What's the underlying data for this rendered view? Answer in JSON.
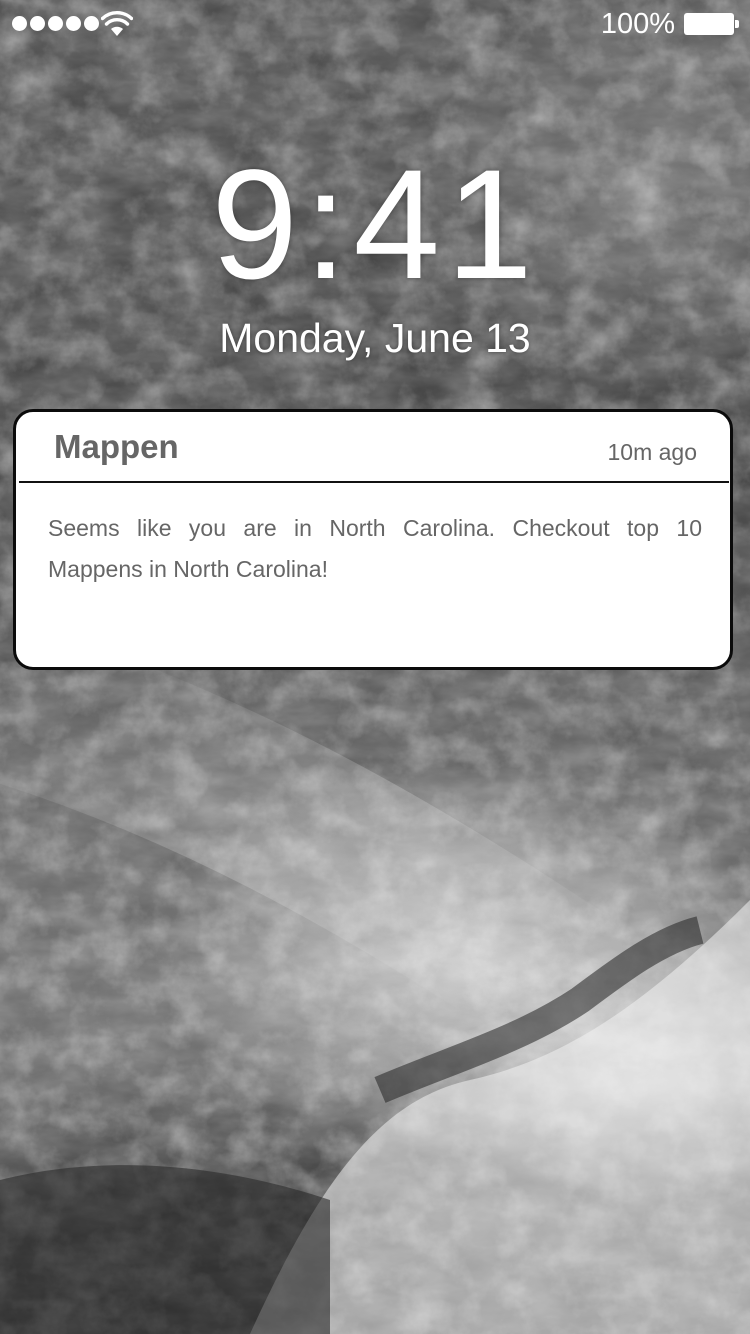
{
  "status_bar": {
    "battery_text": "100%",
    "signal_icon": "signal-dots-icon",
    "wifi_icon": "wifi-icon",
    "battery_icon": "battery-full-icon"
  },
  "lock_screen": {
    "time": "9:41",
    "date": "Monday, June 13"
  },
  "notification": {
    "app_name": "Mappen",
    "time_ago": "10m ago",
    "message": "Seems like you are in North Carolina. Checkout top 10 Mappens in North Carolina!"
  }
}
